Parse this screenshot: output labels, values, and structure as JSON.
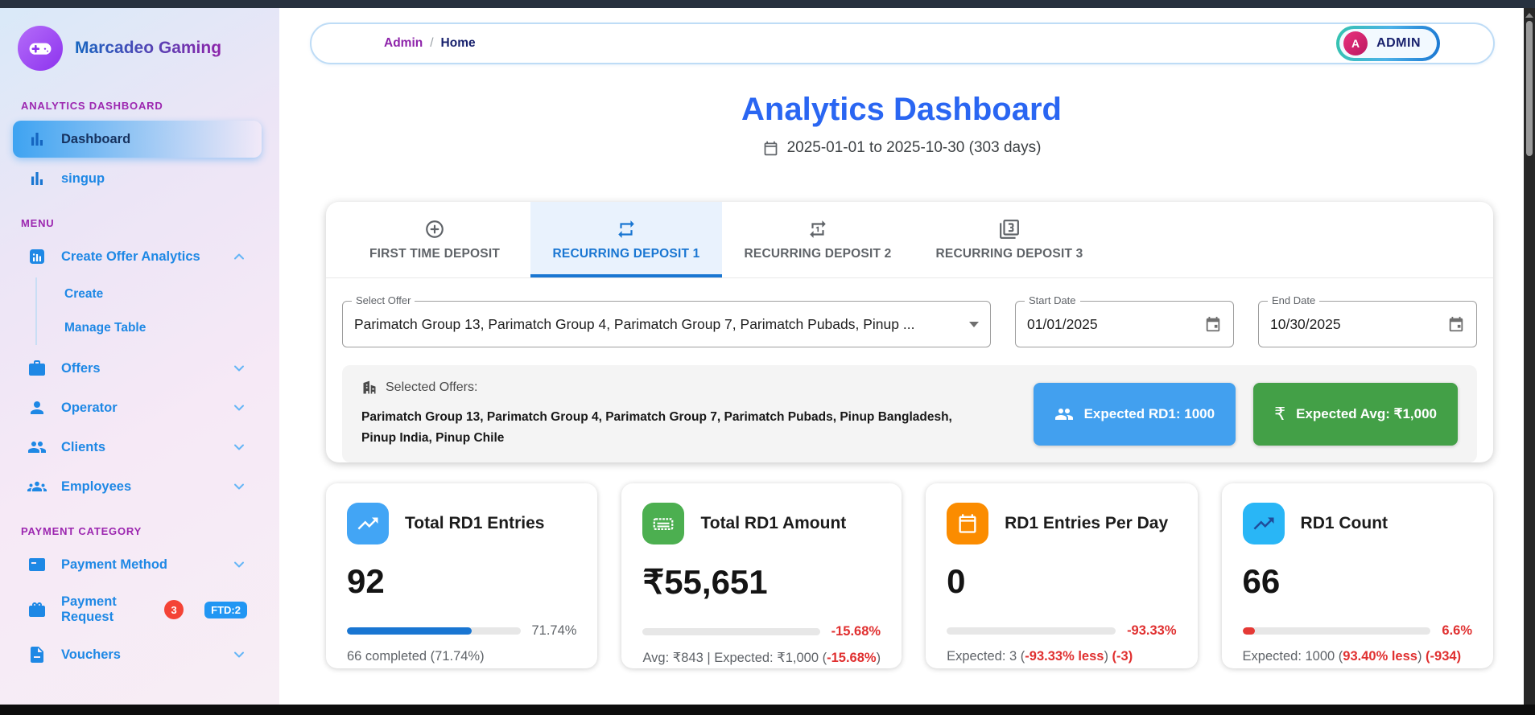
{
  "colors": {
    "negative": "#e03030",
    "accent_blue": "#1976d2",
    "title_blue": "#2a66f2"
  },
  "sidebar": {
    "brand": "Marcadeo Gaming",
    "sections": {
      "analytics": "ANALYTICS DASHBOARD",
      "menu": "MENU",
      "payment": "PAYMENT CATEGORY"
    },
    "items": {
      "dashboard": "Dashboard",
      "singup": "singup",
      "create_offer_analytics": "Create Offer Analytics",
      "create": "Create",
      "manage_table": "Manage Table",
      "offers": "Offers",
      "operator": "Operator",
      "clients": "Clients",
      "employees": "Employees",
      "payment_method": "Payment Method",
      "payment_request": "Payment Request",
      "vouchers": "Vouchers"
    },
    "badges": {
      "payment_request_count": "3",
      "payment_request_ftd": "FTD:2"
    }
  },
  "header": {
    "breadcrumb_parent": "Admin",
    "breadcrumb_separator": "/",
    "breadcrumb_current": "Home",
    "admin_avatar_letter": "A",
    "admin_label": "ADMIN"
  },
  "page": {
    "title": "Analytics Dashboard",
    "date_range": "2025-01-01 to 2025-10-30 (303 days)"
  },
  "tabs": [
    {
      "label": "FIRST TIME DEPOSIT",
      "icon": "plus-circle-icon",
      "active": false
    },
    {
      "label": "RECURRING DEPOSIT 1",
      "icon": "repeat-icon",
      "active": true
    },
    {
      "label": "RECURRING DEPOSIT 2",
      "icon": "repeat-one-icon",
      "active": false
    },
    {
      "label": "RECURRING DEPOSIT 3",
      "icon": "filter-3-icon",
      "active": false
    }
  ],
  "filters": {
    "select_offer_label": "Select Offer",
    "select_offer_value": "Parimatch Group 13, Parimatch Group 4, Parimatch Group 7, Parimatch Pubads, Pinup ...",
    "start_date_label": "Start Date",
    "start_date_value": "01/01/2025",
    "end_date_label": "End Date",
    "end_date_value": "10/30/2025"
  },
  "selected_offers": {
    "label": "Selected Offers:",
    "value": "Parimatch Group 13, Parimatch Group 4, Parimatch Group 7, Parimatch Pubads, Pinup Bangladesh, Pinup India, Pinup Chile",
    "rd1_badge": "Expected RD1: 1000",
    "rd1_badge_color": "#42a0ef",
    "avg_badge": "Expected Avg: ₹1,000",
    "avg_badge_color": "#43a047"
  },
  "stat_cards": [
    {
      "title": "Total RD1 Entries",
      "value": "92",
      "icon": "trending-up-icon",
      "icon_color": "#42a5f5",
      "progress_pct": 71.74,
      "progress_color": "#1976d2",
      "pct_label": "71.74%",
      "pct_color": "#5f6368",
      "footer_pre": "66 completed (71.74%)",
      "footer_red1": "",
      "footer_mid": "",
      "footer_red2": ""
    },
    {
      "title": "Total RD1 Amount",
      "value": "₹55,651",
      "icon": "banknote-icon",
      "icon_color": "#4caf50",
      "progress_pct": 0,
      "progress_color": "#1976d2",
      "pct_label": "-15.68%",
      "pct_color": "#e03030",
      "footer_pre": "Avg: ₹843 | Expected: ₹1,000 (",
      "footer_red1": "-15.68%",
      "footer_mid": ")",
      "footer_red2": ""
    },
    {
      "title": "RD1 Entries Per Day",
      "value": "0",
      "icon": "calendar-icon",
      "icon_color": "#fb8c00",
      "progress_pct": 0,
      "progress_color": "#1976d2",
      "pct_label": "-93.33%",
      "pct_color": "#e03030",
      "footer_pre": "Expected: 3 (",
      "footer_red1": "-93.33% less",
      "footer_mid": ")  ",
      "footer_red2": "(-3)"
    },
    {
      "title": "RD1 Count",
      "value": "66",
      "icon": "trending-up-icon",
      "icon_color": "#29b6f6",
      "progress_pct": 6.6,
      "progress_color": "#e53935",
      "pct_label": "6.6%",
      "pct_color": "#e03030",
      "footer_pre": "Expected: 1000 (",
      "footer_red1": "93.40% less",
      "footer_mid": ")  ",
      "footer_red2": "(-934)"
    }
  ]
}
